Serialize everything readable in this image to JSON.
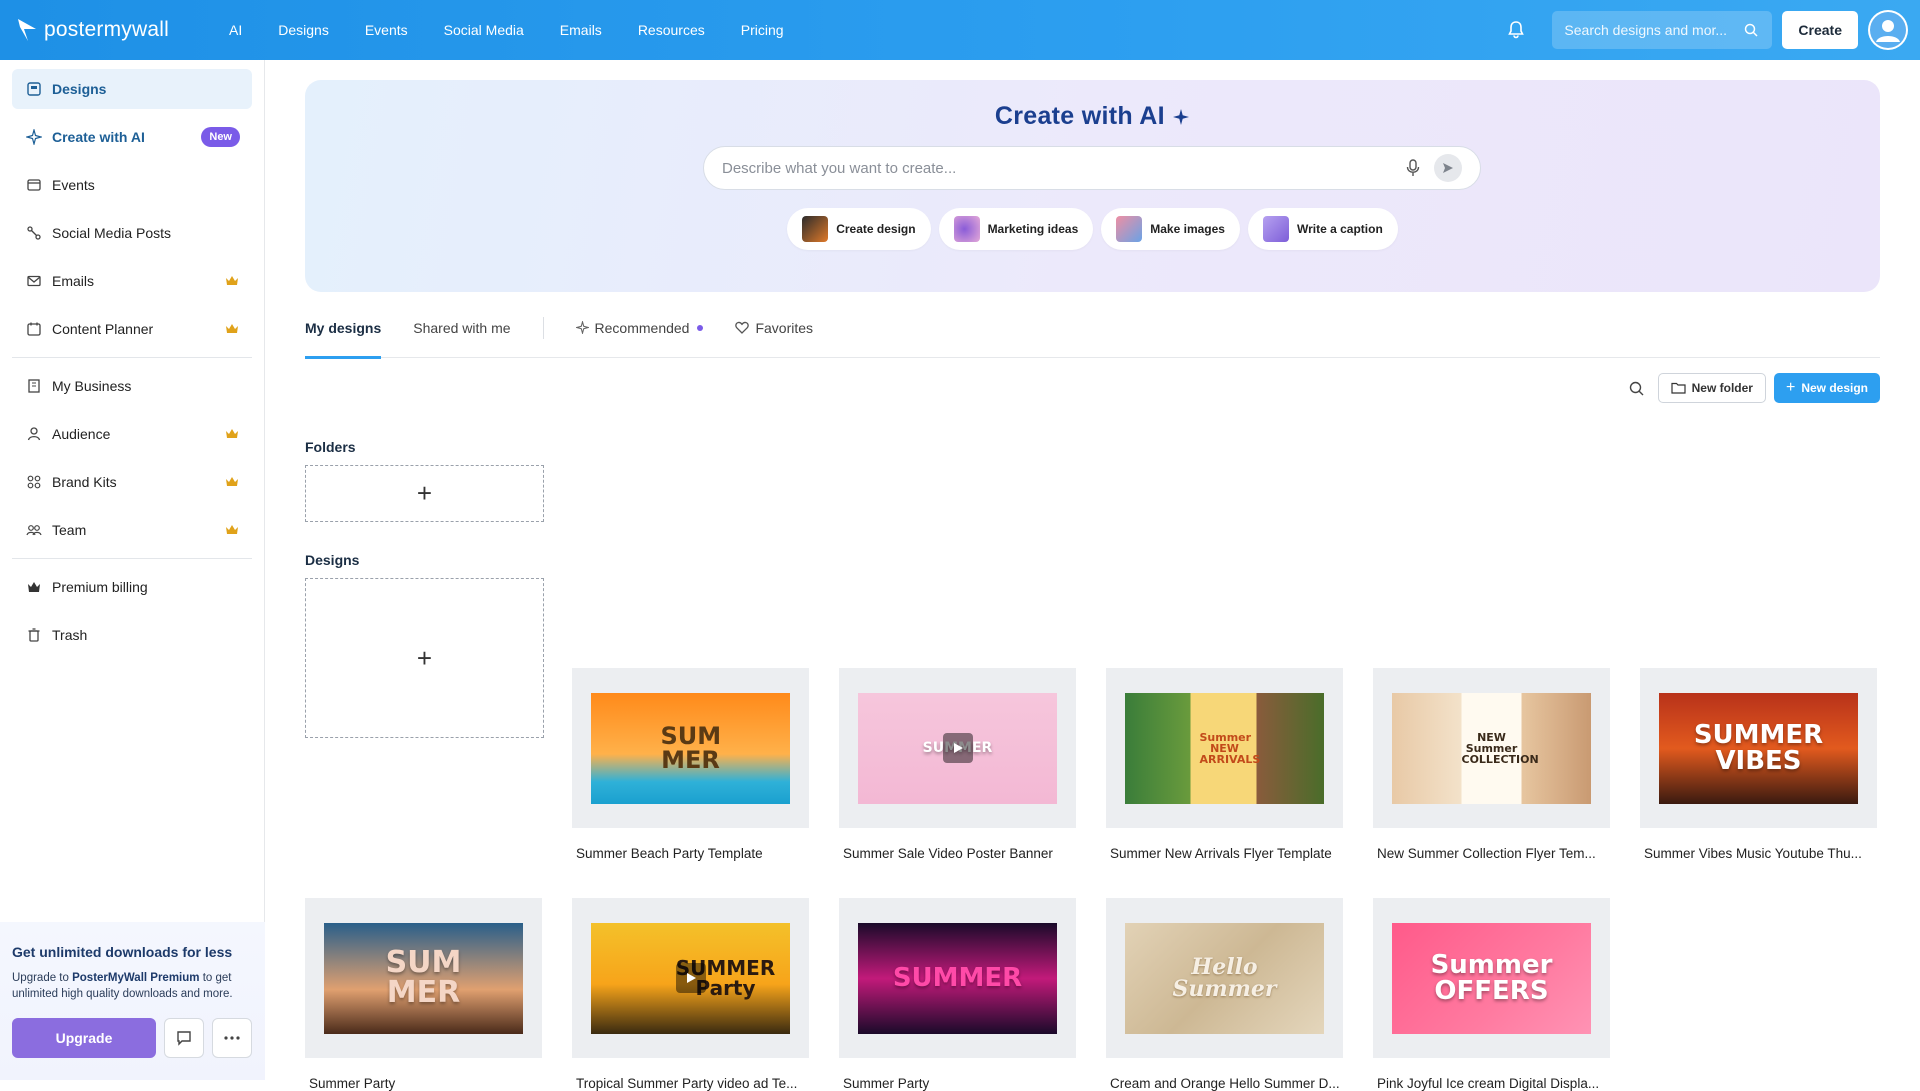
{
  "brand": {
    "name": "postermywall",
    "accent": "#2d9ff0",
    "premium": "#8b6ddf"
  },
  "nav": [
    "AI",
    "Designs",
    "Events",
    "Social Media",
    "Emails",
    "Resources",
    "Pricing"
  ],
  "header": {
    "search_placeholder": "Search designs and mor...",
    "create_label": "Create"
  },
  "sidebar": {
    "items": [
      {
        "label": "Designs",
        "icon": "designs-icon",
        "active": true
      },
      {
        "label": "Create with AI",
        "icon": "sparkle-icon",
        "badge": "New"
      },
      {
        "label": "Events",
        "icon": "events-icon"
      },
      {
        "label": "Social Media Posts",
        "icon": "social-icon"
      },
      {
        "label": "Emails",
        "icon": "mail-icon",
        "premium": true
      },
      {
        "label": "Content Planner",
        "icon": "calendar-icon",
        "premium": true
      }
    ],
    "items2": [
      {
        "label": "My Business",
        "icon": "building-icon"
      },
      {
        "label": "Audience",
        "icon": "person-icon",
        "premium": true
      },
      {
        "label": "Brand Kits",
        "icon": "grid-icon",
        "premium": true
      },
      {
        "label": "Team",
        "icon": "team-icon",
        "premium": true
      }
    ],
    "items3": [
      {
        "label": "Premium billing",
        "icon": "crown-icon"
      },
      {
        "label": "Trash",
        "icon": "trash-icon"
      }
    ],
    "promo": {
      "title": "Get unlimited downloads for less",
      "text_before": "Upgrade to ",
      "text_bold": "PosterMyWall Premium",
      "text_after": " to get unlimited high quality downloads and more.",
      "upgrade_label": "Upgrade"
    }
  },
  "ai": {
    "title": "Create with AI",
    "placeholder": "Describe what you want to create...",
    "chips": [
      "Create design",
      "Marketing ideas",
      "Make images",
      "Write a caption"
    ]
  },
  "tabs": {
    "my_designs": "My designs",
    "shared": "Shared with me",
    "recommended": "Recommended",
    "favorites": "Favorites"
  },
  "toolbar": {
    "new_folder": "New folder",
    "new_design": "New design"
  },
  "sections": {
    "folders": "Folders",
    "designs": "Designs"
  },
  "designs": [
    {
      "title": "Summer Beach Party Template",
      "art": "SUM MER",
      "video": false
    },
    {
      "title": "Summer Sale Video Poster Banner",
      "art": "SUMMER",
      "video": true
    },
    {
      "title": "Summer New Arrivals Flyer Template",
      "art": "Summer NEW ARRIVALS",
      "video": false
    },
    {
      "title": "New Summer Collection Flyer Tem...",
      "art": "NEW Summer COLLECTION",
      "video": false
    },
    {
      "title": "Summer Vibes Music Youtube Thu...",
      "art": "SUMMER VIBES",
      "video": false
    },
    {
      "title": "Summer Party",
      "art": "SUM MER",
      "video": false
    },
    {
      "title": "Tropical Summer Party video ad Te...",
      "art": "SUMMER Party",
      "video": true
    },
    {
      "title": "Summer Party",
      "art": "SUMMER",
      "video": false
    },
    {
      "title": "Cream and Orange Hello Summer D...",
      "art": "Hello Summer",
      "video": false
    },
    {
      "title": "Pink Joyful Ice cream Digital Displa...",
      "art": "Summer OFFERS",
      "video": false
    }
  ]
}
